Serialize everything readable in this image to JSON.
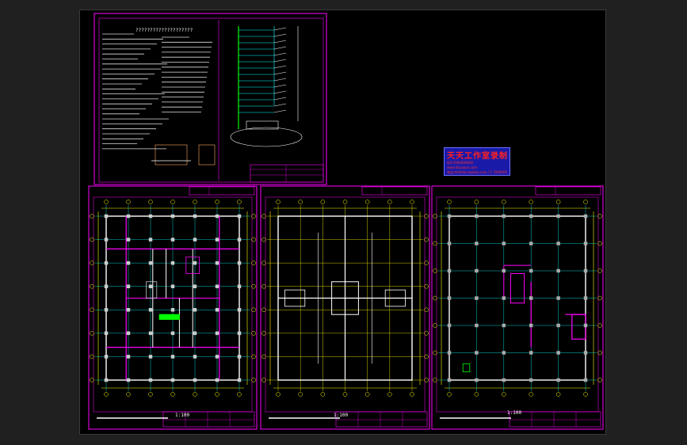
{
  "watermark": {
    "title": "天天工作室录制",
    "line1": "QQ:2000000000",
    "line2": "www.ttsuoyun.com",
    "line3": "淘宝:ttzhidao.taobao.com / 1.7000000"
  },
  "sheets": {
    "notes": {
      "heading": "????????????????????"
    },
    "plan1": {
      "scale": "1:100"
    },
    "plan2": {
      "scale": "1:100"
    },
    "plan3": {
      "scale": "1:100"
    }
  },
  "colors": {
    "background": "#000000",
    "frame": "#ff00ff",
    "axis": "#00ffff",
    "wall": "#ffffff",
    "dim": "#ffff00",
    "room": "#ff00ff",
    "stair": "#00ff00"
  }
}
